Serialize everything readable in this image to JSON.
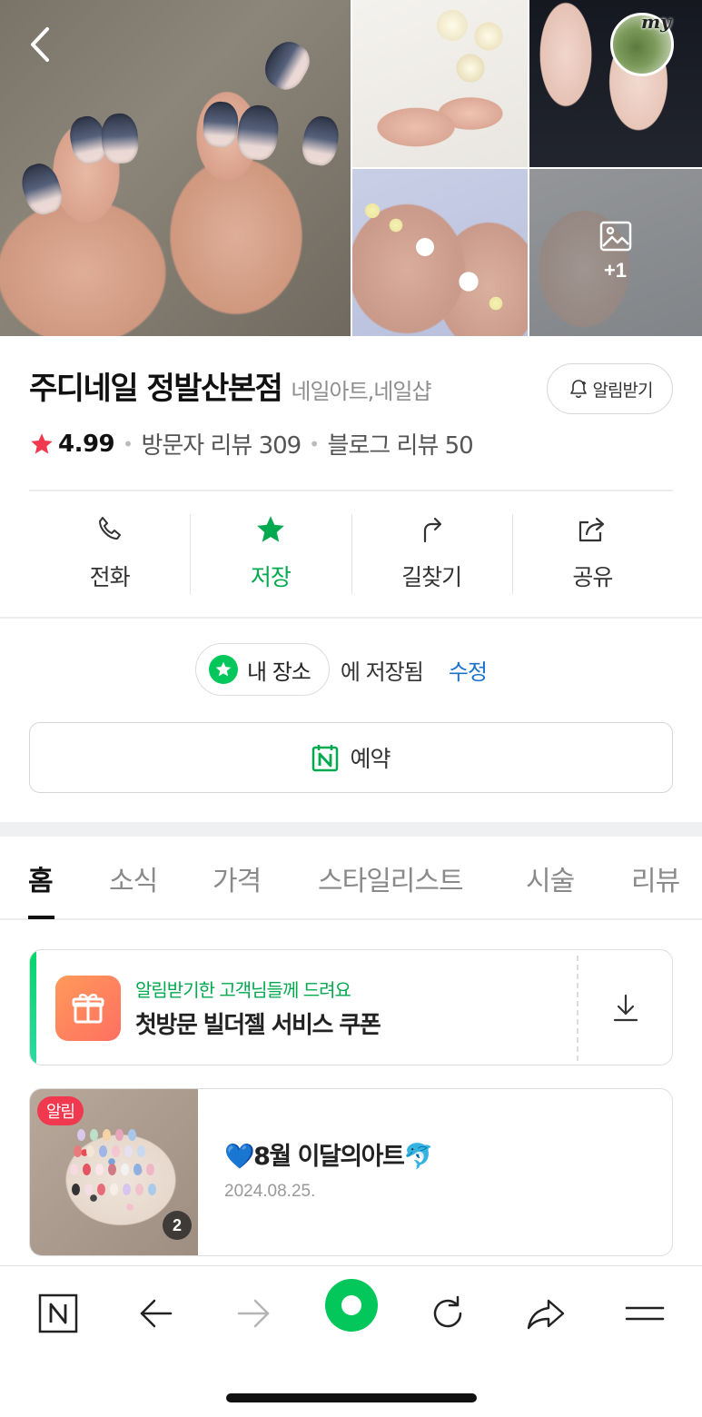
{
  "gallery": {
    "profile_badge": "my",
    "more_photos": "+1"
  },
  "place": {
    "name": "주디네일 정발산본점",
    "category": "네일아트,네일샵",
    "notify_label": "알림받기",
    "rating": "4.99",
    "visitor_reviews": "방문자 리뷰 309",
    "blog_reviews": "블로그 리뷰 50"
  },
  "actions": [
    {
      "label": "전화",
      "icon": "phone-icon"
    },
    {
      "label": "저장",
      "icon": "star-icon",
      "active": true
    },
    {
      "label": "길찾기",
      "icon": "directions-icon"
    },
    {
      "label": "공유",
      "icon": "share-icon"
    }
  ],
  "saved": {
    "chip_label": "내 장소",
    "text": "에 저장됨",
    "edit": "수정"
  },
  "reserve": {
    "label": "예약"
  },
  "tabs": [
    "홈",
    "소식",
    "가격",
    "스타일리스트",
    "시술",
    "리뷰"
  ],
  "active_tab": "홈",
  "coupon": {
    "subtitle": "알림받기한 고객님들께 드려요",
    "title": "첫방문 빌더젤 서비스 쿠폰"
  },
  "news": {
    "badge": "알림",
    "count": "2",
    "title": "💙8월 이달의아트🐬",
    "date": "2024.08.25."
  },
  "colors": {
    "accent_green": "#03c75a",
    "link_blue": "#1a73c9",
    "rating_red": "#f0394e"
  }
}
